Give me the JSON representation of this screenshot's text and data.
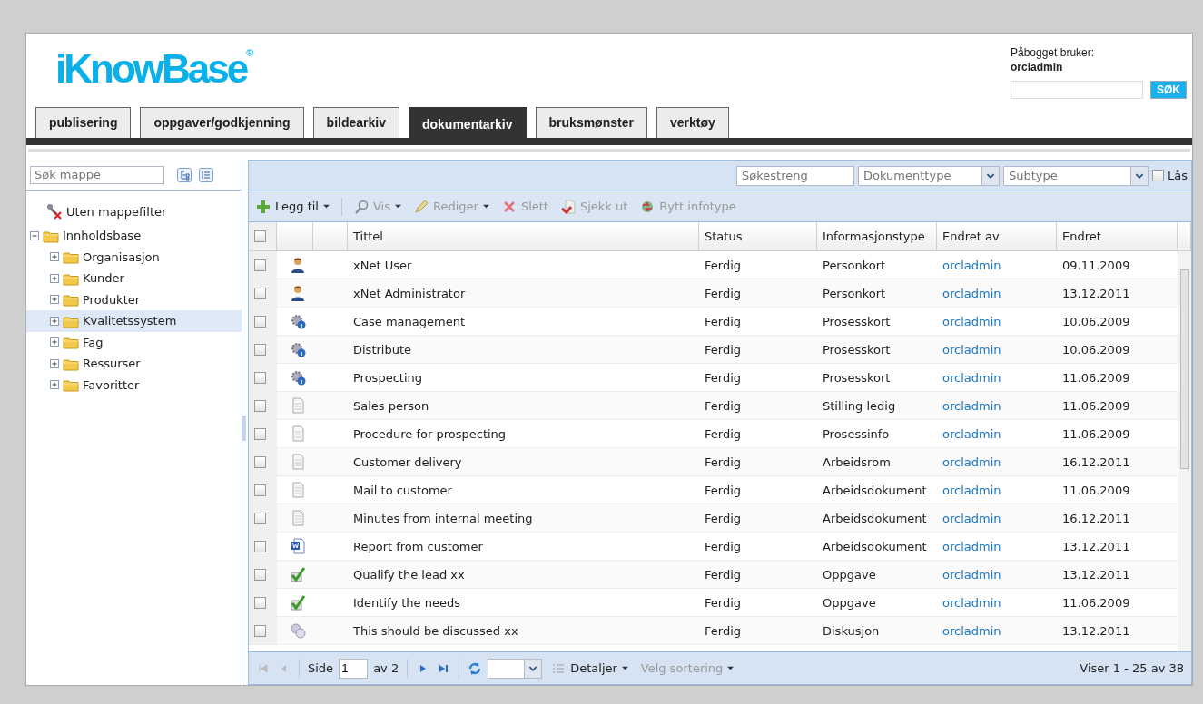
{
  "logo": {
    "text": "iKnowBase",
    "mark": "®"
  },
  "user": {
    "label": "Påbogget bruker:",
    "name": "orcladmin"
  },
  "search": {
    "button": "SØK"
  },
  "tabs": [
    {
      "label": "publisering",
      "selected": false
    },
    {
      "label": "oppgaver/godkjenning",
      "selected": false
    },
    {
      "label": "bildearkiv",
      "selected": false
    },
    {
      "label": "dokumentarkiv",
      "selected": true
    },
    {
      "label": "bruksmønster",
      "selected": false
    },
    {
      "label": "verktøy",
      "selected": false
    }
  ],
  "sidebar": {
    "search_placeholder": "Søk mappe",
    "filter_item": "Uten mappefilter",
    "tree": [
      {
        "label": "Innholdsbase",
        "expanded": true,
        "selected": false,
        "children": [
          {
            "label": "Organisasjon",
            "expanded": false,
            "selected": false
          },
          {
            "label": "Kunder",
            "expanded": false,
            "selected": false
          },
          {
            "label": "Produkter",
            "expanded": false,
            "selected": false
          },
          {
            "label": "Kvalitetssystem",
            "expanded": false,
            "selected": true
          },
          {
            "label": "Fag",
            "expanded": false,
            "selected": false
          },
          {
            "label": "Ressurser",
            "expanded": false,
            "selected": false
          },
          {
            "label": "Favoritter",
            "expanded": false,
            "selected": false
          }
        ]
      }
    ]
  },
  "filters": {
    "search_placeholder": "Søkestreng",
    "doctype_placeholder": "Dokumenttype",
    "subtype_placeholder": "Subtype",
    "lock_label": "Lås",
    "lock_checked": false
  },
  "toolbar": [
    {
      "kind": "add",
      "label": "Legg til",
      "menu": true,
      "disabled": false
    },
    {
      "kind": "view",
      "label": "Vis",
      "menu": true,
      "disabled": true
    },
    {
      "kind": "edit",
      "label": "Rediger",
      "menu": true,
      "disabled": true
    },
    {
      "kind": "delete",
      "label": "Slett",
      "menu": false,
      "disabled": true
    },
    {
      "kind": "checkout",
      "label": "Sjekk ut",
      "menu": false,
      "disabled": true
    },
    {
      "kind": "swap",
      "label": "Bytt infotype",
      "menu": false,
      "disabled": true
    }
  ],
  "table": {
    "select_all_checked": false,
    "columns": [
      "Tittel",
      "Status",
      "Informasjonstype",
      "Endret av",
      "Endret"
    ],
    "rows": [
      {
        "kind": "person",
        "checked": false,
        "cells": [
          "xNet User",
          "Ferdig",
          "Personkort",
          "orcladmin",
          "09.11.2009"
        ]
      },
      {
        "kind": "person",
        "checked": false,
        "cells": [
          "xNet Administrator",
          "Ferdig",
          "Personkort",
          "orcladmin",
          "13.12.2011"
        ]
      },
      {
        "kind": "process",
        "checked": false,
        "cells": [
          "Case management",
          "Ferdig",
          "Prosesskort",
          "orcladmin",
          "10.06.2009"
        ]
      },
      {
        "kind": "process",
        "checked": false,
        "cells": [
          "Distribute",
          "Ferdig",
          "Prosesskort",
          "orcladmin",
          "10.06.2009"
        ]
      },
      {
        "kind": "process",
        "checked": false,
        "cells": [
          "Prospecting",
          "Ferdig",
          "Prosesskort",
          "orcladmin",
          "11.06.2009"
        ]
      },
      {
        "kind": "document",
        "checked": false,
        "cells": [
          "Sales person",
          "Ferdig",
          "Stilling ledig",
          "orcladmin",
          "11.06.2009"
        ]
      },
      {
        "kind": "document",
        "checked": false,
        "cells": [
          "Procedure for prospecting",
          "Ferdig",
          "Prosessinfo",
          "orcladmin",
          "11.06.2009"
        ]
      },
      {
        "kind": "document",
        "checked": false,
        "cells": [
          "Customer delivery",
          "Ferdig",
          "Arbeidsrom",
          "orcladmin",
          "16.12.2011"
        ]
      },
      {
        "kind": "document",
        "checked": false,
        "cells": [
          "Mail to customer",
          "Ferdig",
          "Arbeidsdokument",
          "orcladmin",
          "11.06.2009"
        ]
      },
      {
        "kind": "document",
        "checked": false,
        "cells": [
          "Minutes from internal meeting",
          "Ferdig",
          "Arbeidsdokument",
          "orcladmin",
          "16.12.2011"
        ]
      },
      {
        "kind": "word",
        "checked": false,
        "cells": [
          "Report from customer",
          "Ferdig",
          "Arbeidsdokument",
          "orcladmin",
          "13.12.2011"
        ]
      },
      {
        "kind": "task",
        "checked": false,
        "cells": [
          "Qualify the lead xx",
          "Ferdig",
          "Oppgave",
          "orcladmin",
          "13.12.2011"
        ]
      },
      {
        "kind": "task",
        "checked": false,
        "cells": [
          "Identify the needs",
          "Ferdig",
          "Oppgave",
          "orcladmin",
          "11.06.2009"
        ]
      },
      {
        "kind": "discussion",
        "checked": false,
        "cells": [
          "This should be discussed xx",
          "Ferdig",
          "Diskusjon",
          "orcladmin",
          "13.12.2011"
        ]
      }
    ]
  },
  "pager": {
    "page_label": "Side",
    "page": "1",
    "of": "av 2",
    "view": "Detaljer",
    "sort": "Velg sortering",
    "summary": "Viser 1 - 25 av 38"
  }
}
